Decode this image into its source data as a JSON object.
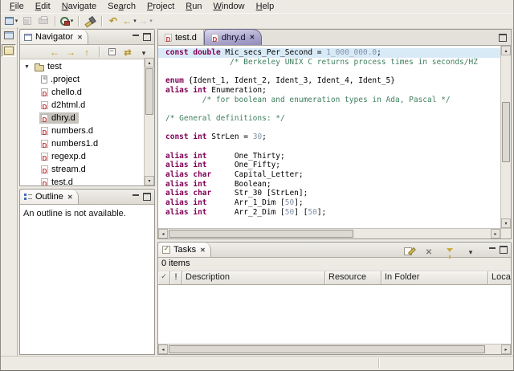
{
  "colors": {
    "keyword": "#7F0055",
    "comment": "#3F7F5F",
    "number": "#8292AC",
    "line_highlight": "#D9EAF7",
    "active_tab": "#918BBA",
    "d_icon": "#C03030",
    "selection_inactive": "#C6C3BC"
  },
  "menubar": {
    "items": [
      {
        "label": "File",
        "mnemonic_index": 0
      },
      {
        "label": "Edit",
        "mnemonic_index": 0
      },
      {
        "label": "Navigate",
        "mnemonic_index": 0
      },
      {
        "label": "Search",
        "mnemonic_index": 2
      },
      {
        "label": "Project",
        "mnemonic_index": 0
      },
      {
        "label": "Run",
        "mnemonic_index": 0
      },
      {
        "label": "Window",
        "mnemonic_index": 0
      },
      {
        "label": "Help",
        "mnemonic_index": 0
      }
    ]
  },
  "toolbar": {
    "items": [
      {
        "icon": "new-wizard",
        "dropdown": true,
        "enabled": true
      },
      {
        "icon": "save",
        "enabled": false
      },
      {
        "icon": "print",
        "enabled": false
      },
      {
        "sep": true
      },
      {
        "icon": "external-tools",
        "dropdown": true,
        "enabled": true
      },
      {
        "sep": true
      },
      {
        "icon": "search",
        "enabled": true
      },
      {
        "sep": true
      },
      {
        "icon": "last-edit-location",
        "enabled": true
      },
      {
        "icon": "back",
        "dropdown": true,
        "enabled": true
      },
      {
        "icon": "forward",
        "dropdown": true,
        "enabled": false
      }
    ]
  },
  "perspective_bar": {
    "open_button": "Open Perspective",
    "active_perspective": "Resource"
  },
  "navigator": {
    "title": "Navigator",
    "toolbar": [
      {
        "icon": "back"
      },
      {
        "icon": "forward"
      },
      {
        "icon": "up"
      },
      {
        "sep": true
      },
      {
        "icon": "collapse-all"
      },
      {
        "icon": "link-with-editor"
      },
      {
        "icon": "view-menu"
      }
    ],
    "tree": {
      "root": {
        "label": "test",
        "expanded": true
      },
      "children": [
        {
          "label": ".project",
          "icon": "file"
        },
        {
          "label": "chello.d",
          "icon": "d"
        },
        {
          "label": "d2html.d",
          "icon": "d"
        },
        {
          "label": "dhry.d",
          "icon": "d",
          "selected": true
        },
        {
          "label": "numbers.d",
          "icon": "d"
        },
        {
          "label": "numbers1.d",
          "icon": "d"
        },
        {
          "label": "regexp.d",
          "icon": "d"
        },
        {
          "label": "stream.d",
          "icon": "d"
        },
        {
          "label": "test.d",
          "icon": "d"
        }
      ]
    }
  },
  "outline": {
    "title": "Outline",
    "message": "An outline is not available."
  },
  "editor": {
    "tabs": [
      {
        "label": "test.d",
        "active": false,
        "closable": false
      },
      {
        "label": "dhry.d",
        "active": true,
        "closable": true
      }
    ],
    "code": {
      "lines": [
        {
          "hl": true,
          "segs": [
            [
              "k",
              "const"
            ],
            [
              "p",
              " "
            ],
            [
              "k",
              "double"
            ],
            [
              "p",
              " Mic_secs_Per_Second = "
            ],
            [
              "n",
              "1_000_000.0"
            ],
            [
              "p",
              ";"
            ]
          ]
        },
        {
          "segs": [
            [
              "c",
              "              /* Berkeley UNIX C returns process times in seconds/HZ"
            ]
          ]
        },
        {
          "segs": []
        },
        {
          "segs": [
            [
              "k",
              "enum"
            ],
            [
              "p",
              " {Ident_1, Ident_2, Ident_3, Ident_4, Ident_5}"
            ]
          ]
        },
        {
          "segs": [
            [
              "k",
              "alias"
            ],
            [
              "p",
              " "
            ],
            [
              "k",
              "int"
            ],
            [
              "p",
              " Enumeration;"
            ]
          ]
        },
        {
          "segs": [
            [
              "c",
              "        /* for boolean and enumeration types in Ada, Pascal */"
            ]
          ]
        },
        {
          "segs": []
        },
        {
          "segs": [
            [
              "c",
              "/* General definitions: */"
            ]
          ]
        },
        {
          "segs": []
        },
        {
          "segs": [
            [
              "k",
              "const"
            ],
            [
              "p",
              " "
            ],
            [
              "k",
              "int"
            ],
            [
              "p",
              " StrLen = "
            ],
            [
              "n",
              "30"
            ],
            [
              "p",
              ";"
            ]
          ]
        },
        {
          "segs": []
        },
        {
          "segs": [
            [
              "k",
              "alias"
            ],
            [
              "p",
              " "
            ],
            [
              "k",
              "int"
            ],
            [
              "p",
              "      One_Thirty;"
            ]
          ]
        },
        {
          "segs": [
            [
              "k",
              "alias"
            ],
            [
              "p",
              " "
            ],
            [
              "k",
              "int"
            ],
            [
              "p",
              "      One_Fifty;"
            ]
          ]
        },
        {
          "segs": [
            [
              "k",
              "alias"
            ],
            [
              "p",
              " "
            ],
            [
              "k",
              "char"
            ],
            [
              "p",
              "     Capital_Letter;"
            ]
          ]
        },
        {
          "segs": [
            [
              "k",
              "alias"
            ],
            [
              "p",
              " "
            ],
            [
              "k",
              "int"
            ],
            [
              "p",
              "      Boolean;"
            ]
          ]
        },
        {
          "segs": [
            [
              "k",
              "alias"
            ],
            [
              "p",
              " "
            ],
            [
              "k",
              "char"
            ],
            [
              "p",
              "     Str_30 [StrLen];"
            ]
          ]
        },
        {
          "segs": [
            [
              "k",
              "alias"
            ],
            [
              "p",
              " "
            ],
            [
              "k",
              "int"
            ],
            [
              "p",
              "      Arr_1_Dim ["
            ],
            [
              "n",
              "50"
            ],
            [
              "p",
              "];"
            ]
          ]
        },
        {
          "segs": [
            [
              "k",
              "alias"
            ],
            [
              "p",
              " "
            ],
            [
              "k",
              "int"
            ],
            [
              "p",
              "      Arr_2_Dim ["
            ],
            [
              "n",
              "50"
            ],
            [
              "p",
              "] ["
            ],
            [
              "n",
              "50"
            ],
            [
              "p",
              "];"
            ]
          ]
        }
      ]
    }
  },
  "tasks": {
    "title": "Tasks",
    "count_label": "0 items",
    "columns": [
      {
        "label": "✓",
        "key": "complete"
      },
      {
        "label": "!",
        "key": "priority"
      },
      {
        "label": "Description",
        "key": "description"
      },
      {
        "label": "Resource",
        "key": "resource"
      },
      {
        "label": "In Folder",
        "key": "in-folder"
      },
      {
        "label": "Location",
        "key": "location"
      }
    ],
    "toolbar": [
      {
        "icon": "new-task"
      },
      {
        "icon": "delete"
      },
      {
        "icon": "filter"
      },
      {
        "icon": "view-menu"
      }
    ],
    "rows": []
  },
  "statusbar": {
    "text": ""
  }
}
